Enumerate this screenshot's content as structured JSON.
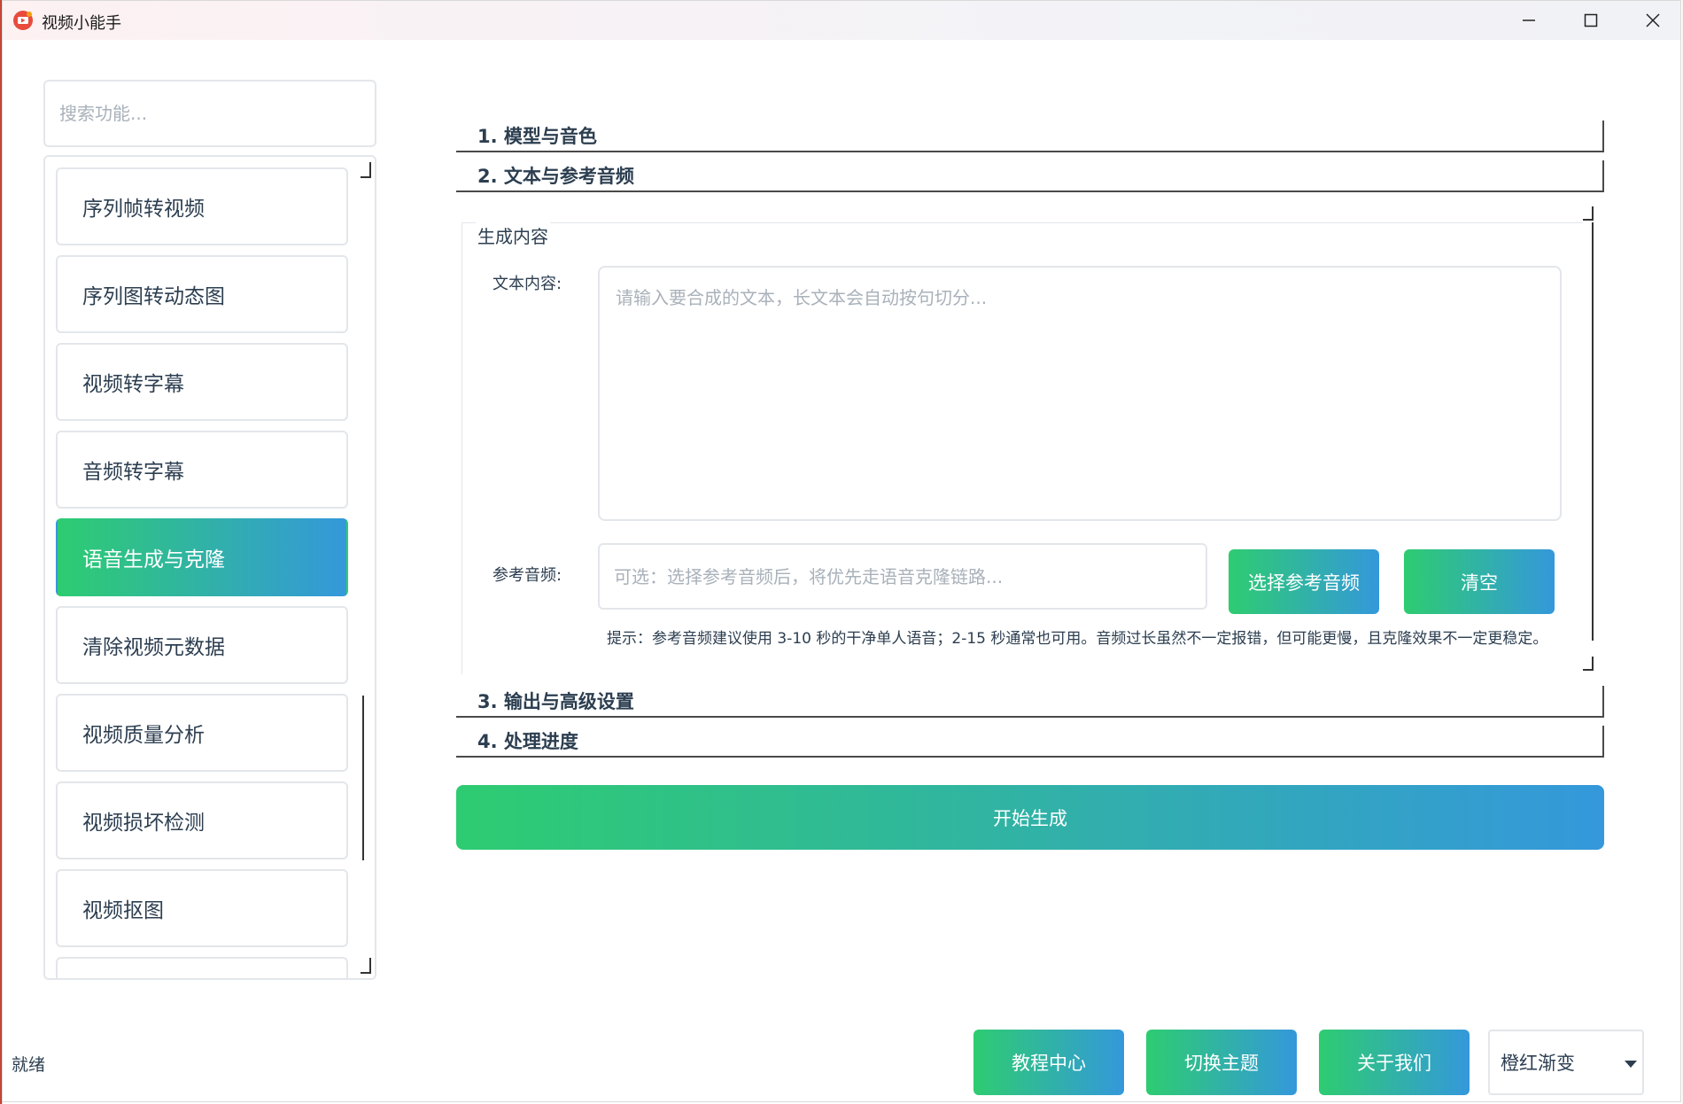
{
  "window": {
    "title": "视频小能手"
  },
  "sidebar": {
    "search_placeholder": "搜索功能...",
    "items": [
      {
        "label": "序列帧转视频"
      },
      {
        "label": "序列图转动态图"
      },
      {
        "label": "视频转字幕"
      },
      {
        "label": "音频转字幕"
      },
      {
        "label": "语音生成与克隆",
        "active": true
      },
      {
        "label": "清除视频元数据"
      },
      {
        "label": "视频质量分析"
      },
      {
        "label": "视频损坏检测"
      },
      {
        "label": "视频抠图"
      }
    ]
  },
  "main": {
    "sections": [
      {
        "title": "1. 模型与音色"
      },
      {
        "title": "2. 文本与参考音频"
      },
      {
        "title": "3. 输出与高级设置"
      },
      {
        "title": "4. 处理进度"
      }
    ],
    "group": {
      "title": "生成内容",
      "text_label": "文本内容:",
      "text_placeholder": "请输入要合成的文本，长文本会自动按句切分...",
      "ref_label": "参考音频:",
      "ref_placeholder": "可选：选择参考音频后，将优先走语音克隆链路...",
      "choose_ref_button": "选择参考音频",
      "clear_button": "清空",
      "hint": "提示：参考音频建议使用 3-10 秒的干净单人语音；2-15 秒通常也可用。音频过长虽然不一定报错，但可能更慢，且克隆效果不一定更稳定。"
    },
    "start_button": "开始生成"
  },
  "footer": {
    "status": "就绪",
    "tutorial_button": "教程中心",
    "switch_theme_button": "切换主题",
    "about_button": "关于我们",
    "theme_value": "橙红渐变"
  },
  "colors": {
    "accent_start": "#2ecc71",
    "accent_end": "#3498db",
    "text": "#2c3e50",
    "border": "#e3e6ea"
  }
}
